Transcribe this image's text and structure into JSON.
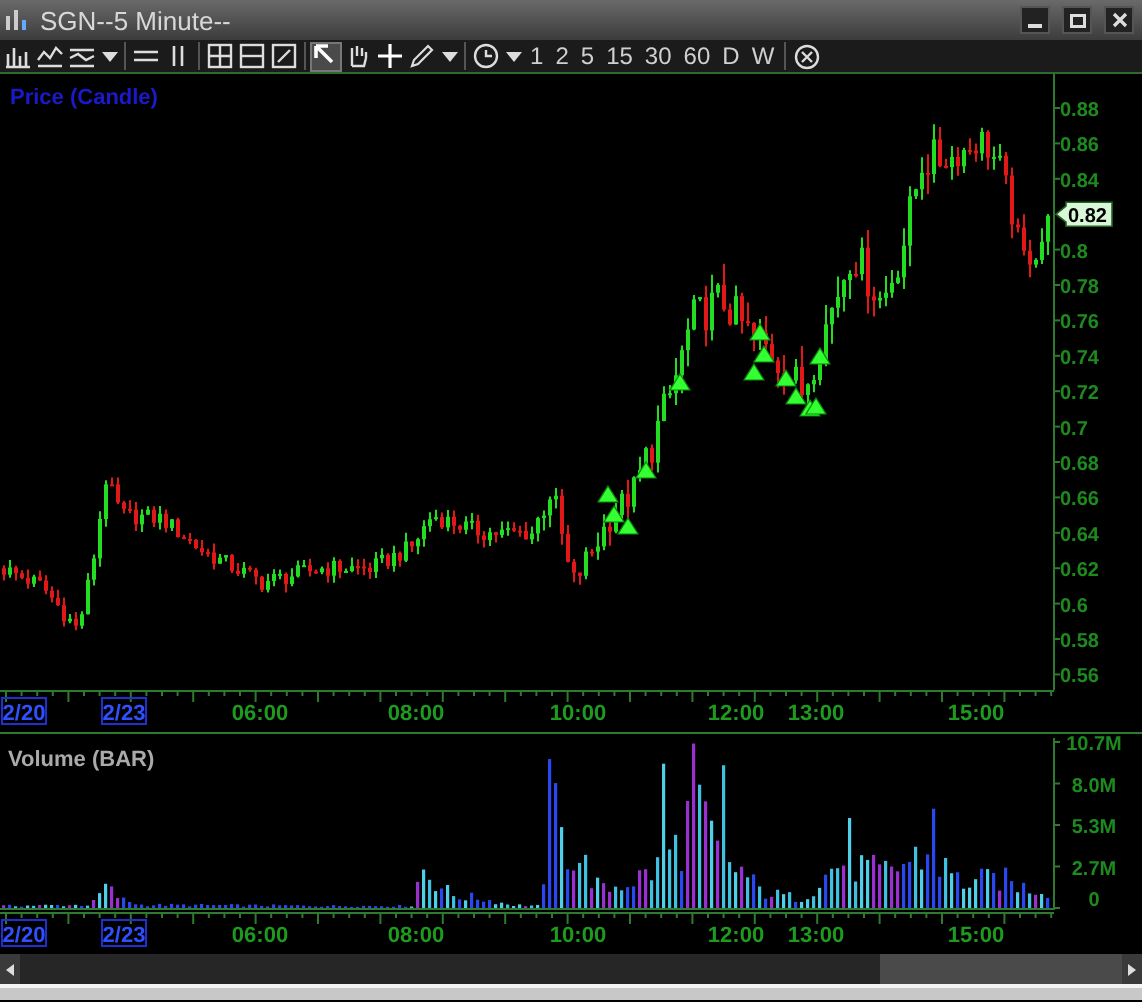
{
  "window": {
    "title": "SGN--5 Minute--"
  },
  "toolbar": {
    "tools": [
      {
        "kind": "bars",
        "selected": false
      },
      {
        "kind": "wave",
        "selected": false
      },
      {
        "kind": "wave2",
        "selected": false
      },
      {
        "kind": "caret",
        "selected": false
      },
      {
        "kind": "hlines",
        "selected": false
      },
      {
        "kind": "vlines",
        "selected": false
      },
      {
        "kind": "grid",
        "selected": false
      },
      {
        "kind": "grid2",
        "selected": false
      },
      {
        "kind": "grid3",
        "selected": false
      },
      {
        "kind": "pointer",
        "selected": true
      },
      {
        "kind": "hand",
        "selected": false
      },
      {
        "kind": "crosshair",
        "selected": false
      },
      {
        "kind": "pencil",
        "selected": false
      },
      {
        "kind": "caret",
        "selected": false
      },
      {
        "kind": "clock",
        "selected": false
      },
      {
        "kind": "caret",
        "selected": false
      }
    ],
    "intervals": [
      "1",
      "2",
      "5",
      "15",
      "30",
      "60",
      "D",
      "W"
    ]
  },
  "price_panel": {
    "title": "Price (Candle)",
    "last_price": "0.82",
    "y_ticks": [
      "0.88",
      "0.86",
      "0.84",
      "0.8",
      "0.78",
      "0.76",
      "0.74",
      "0.72",
      "0.7",
      "0.68",
      "0.66",
      "0.64",
      "0.62",
      "0.6",
      "0.58",
      "0.56"
    ]
  },
  "price_time_axis": [
    {
      "label": "2/20",
      "kind": "date"
    },
    {
      "label": "2/23",
      "kind": "date"
    },
    {
      "label": "06:00",
      "kind": "time"
    },
    {
      "label": "08:00",
      "kind": "time"
    },
    {
      "label": "10:00",
      "kind": "time"
    },
    {
      "label": "12:00",
      "kind": "time"
    },
    {
      "label": "13:00",
      "kind": "time"
    },
    {
      "label": "15:00",
      "kind": "time"
    }
  ],
  "volume_panel": {
    "title": "Volume (BAR)",
    "y_ticks": [
      "10.7M",
      "8.0M",
      "5.3M",
      "2.7M",
      "0"
    ]
  },
  "volume_time_axis": [
    {
      "label": "2/20",
      "kind": "date"
    },
    {
      "label": "2/23",
      "kind": "date"
    },
    {
      "label": "06:00",
      "kind": "time"
    },
    {
      "label": "08:00",
      "kind": "time"
    },
    {
      "label": "10:00",
      "kind": "time"
    },
    {
      "label": "12:00",
      "kind": "time"
    },
    {
      "label": "13:00",
      "kind": "time"
    },
    {
      "label": "15:00",
      "kind": "time"
    }
  ]
}
